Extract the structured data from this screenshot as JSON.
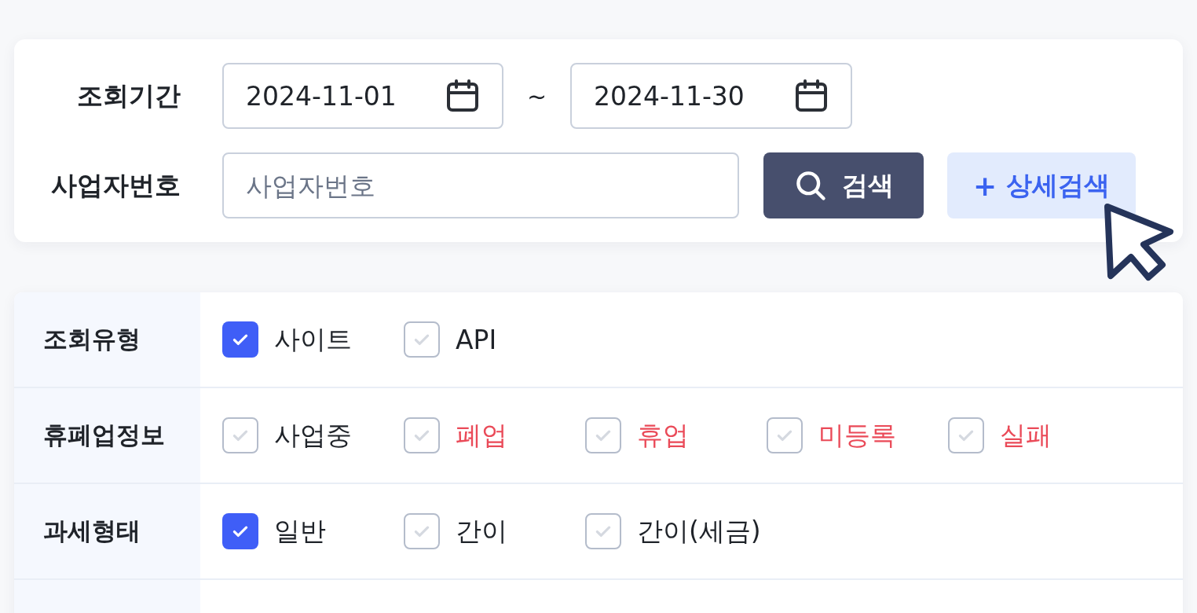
{
  "search_card": {
    "period": {
      "label": "조회기간",
      "start": "2024-11-01",
      "separator": "~",
      "end": "2024-11-30"
    },
    "business_number": {
      "label": "사업자번호",
      "placeholder": "사업자번호"
    },
    "search_button": {
      "label": "검색"
    },
    "detail_search_button": {
      "icon": "+",
      "label": "상세검색"
    }
  },
  "filters": [
    {
      "label": "조회유형",
      "options": [
        {
          "label": "사이트",
          "checked": true,
          "color": "#1f2329"
        },
        {
          "label": "API",
          "checked": false,
          "color": "#1f2329"
        }
      ]
    },
    {
      "label": "휴폐업정보",
      "options": [
        {
          "label": "사업중",
          "checked": false,
          "color": "#1f2329"
        },
        {
          "label": "폐업",
          "checked": false,
          "color": "#ea4a58"
        },
        {
          "label": "휴업",
          "checked": false,
          "color": "#ea4a58"
        },
        {
          "label": "미등록",
          "checked": false,
          "color": "#ea4a58"
        },
        {
          "label": "실패",
          "checked": false,
          "color": "#ea4a58"
        }
      ]
    },
    {
      "label": "과세형태",
      "options": [
        {
          "label": "일반",
          "checked": true,
          "color": "#1f2329"
        },
        {
          "label": "간이",
          "checked": false,
          "color": "#1f2329"
        },
        {
          "label": "간이(세금)",
          "checked": false,
          "color": "#1f2329"
        }
      ]
    }
  ]
}
